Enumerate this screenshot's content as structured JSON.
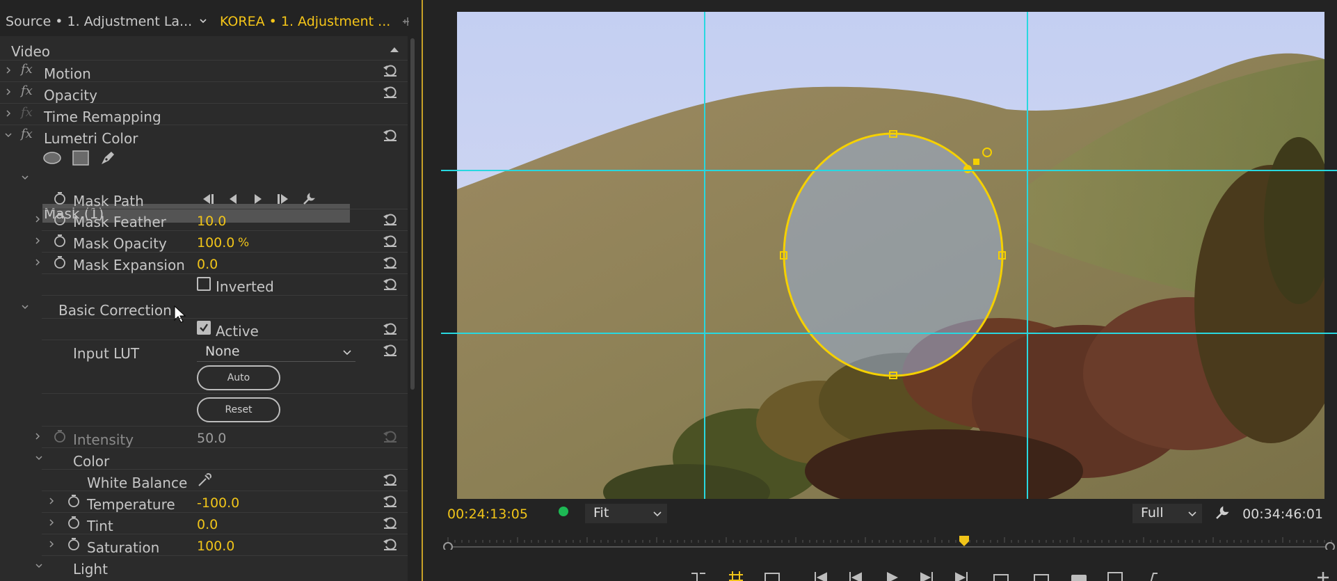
{
  "tabs": {
    "source": "Source • 1. Adjustment La...",
    "active": "KOREA • 1. Adjustment ..."
  },
  "effect_controls": {
    "section": "Video",
    "effects": [
      {
        "name": "Motion"
      },
      {
        "name": "Opacity"
      },
      {
        "name": "Time Remapping"
      },
      {
        "name": "Lumetri Color"
      }
    ],
    "mask_tools": [
      "ellipse-mask-icon",
      "rectangle-mask-icon",
      "pen-mask-icon"
    ],
    "mask": {
      "title": "Mask (1)",
      "path_label": "Mask Path",
      "feather_label": "Mask Feather",
      "feather_value": "10.0",
      "opacity_label": "Mask Opacity",
      "opacity_value": "100.0",
      "opacity_unit": "%",
      "expansion_label": "Mask Expansion",
      "expansion_value": "0.0",
      "inverted_label": "Inverted",
      "inverted": false
    },
    "basic_correction": {
      "title": "Basic Correction",
      "active_label": "Active",
      "active": true,
      "input_lut_label": "Input LUT",
      "input_lut_value": "None",
      "auto_label": "Auto",
      "reset_label": "Reset",
      "intensity_label": "Intensity",
      "intensity_value": "50.0",
      "color_label": "Color",
      "white_balance_label": "White Balance",
      "temperature_label": "Temperature",
      "temperature_value": "-100.0",
      "tint_label": "Tint",
      "tint_value": "0.0",
      "saturation_label": "Saturation",
      "saturation_value": "100.0",
      "light_label": "Light"
    }
  },
  "monitor": {
    "timecode_current": "00:24:13:05",
    "timecode_duration": "00:34:46:01",
    "zoom": "Fit",
    "resolution": "Full",
    "playhead_fraction": 0.585
  },
  "colors": {
    "accent": "#f0c419",
    "guides": "#28d8e0",
    "panel_bg": "#2b2b2b"
  }
}
